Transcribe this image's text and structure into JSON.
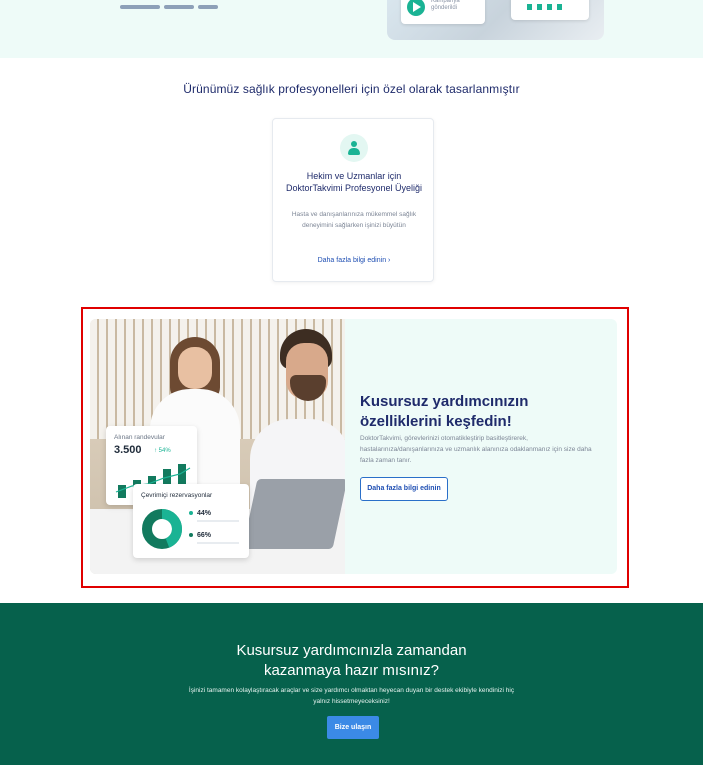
{
  "hero": {
    "card_label": "Kampanya gönderildi"
  },
  "section": {
    "title": "Ürünümüz sağlık profesyonelleri için özel olarak tasarlanmıştır"
  },
  "product_card": {
    "icon": "doctor-icon",
    "title": "Hekim ve Uzmanlar için DoktorTakvimi Profesyonel Üyeliği",
    "description": "Hasta ve danışanlarınıza mükemmel sağlık deneyimini sağlarken işinizi büyütün",
    "link_label": "Daha fazla bilgi edinin",
    "link_arrow": "›"
  },
  "feature": {
    "title": "Kusursuz yardımcınızın özelliklerini keşfedin!",
    "description": "DoktorTakvimi, görevlerinizi otomatikleştirip basitleştirerek, hastalarınıza/danışanlarınıza ve uzmanlık alanınıza odaklanmanız için size daha fazla zaman tanır.",
    "button_label": "Daha fazla bilgi edinin",
    "stat_card": {
      "label": "Alınan randevular",
      "value": "3.500",
      "badge": "↑ 54%",
      "bars": [
        0.35,
        0.5,
        0.62,
        0.8,
        0.95
      ]
    },
    "reservations_card": {
      "label": "Çevrimiçi rezervasyonlar",
      "items": [
        {
          "value": "44%",
          "color": "#1ab394"
        },
        {
          "value": "66%",
          "color": "#127a5e"
        }
      ]
    },
    "highlight_color": "#e00000"
  },
  "cta": {
    "title_line1": "Kusursuz yardımcınızla zamandan",
    "title_line2": "kazanmaya hazır mısınız?",
    "description": "İşinizi tamamen kolaylaştıracak araçlar ve size yardımcı olmaktan heyecan duyan bir destek ekibiyle kendinizi hiç yalnız hissetmeyeceksiniz!",
    "button_label": "Bize ulaşın",
    "background": "#06614c",
    "button_color": "#3b8ae6"
  }
}
